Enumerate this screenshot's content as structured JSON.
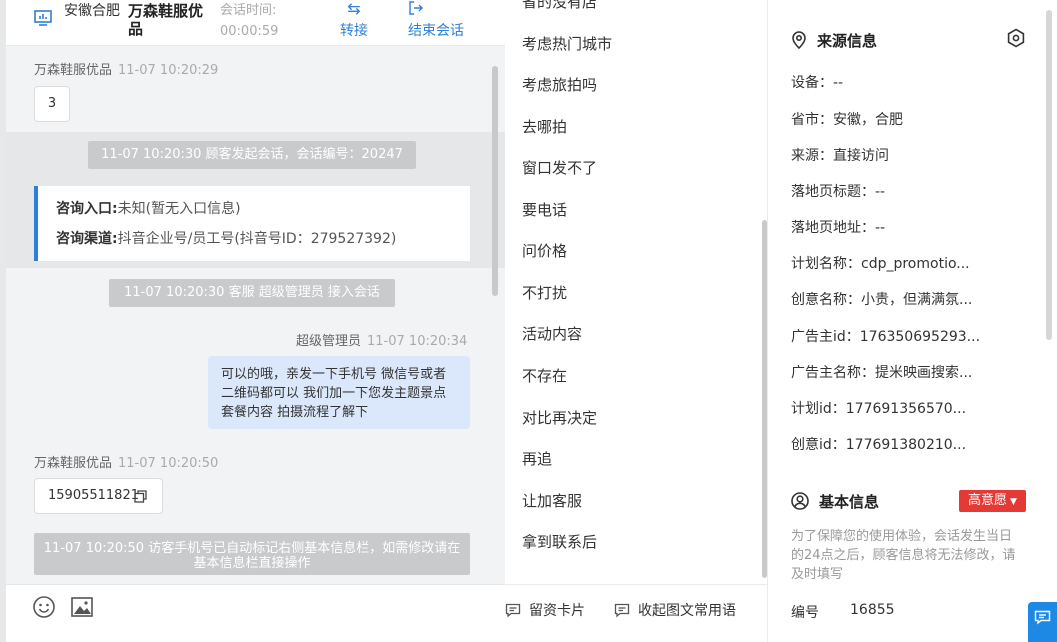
{
  "header": {
    "location": "安徽合肥",
    "shop_name": "万森鞋服优品",
    "time_label": "会话时间:",
    "time_value": "00:00:59",
    "transfer_label": "转接",
    "end_label": "结束会话"
  },
  "messages": {
    "m1_sender": "万森鞋服优品",
    "m1_time": "11-07 10:20:29",
    "m1_text": "3",
    "sys1": "11-07 10:20:30 顾客发起会话，会话编号：20247",
    "entry_label": "咨询入口:",
    "entry_value": "未知(暂无入口信息)",
    "channel_label": "咨询渠道:",
    "channel_value": "抖音企业号/员工号(抖音号ID：279527392)",
    "sys2": "11-07 10:20:30 客服 超级管理员 接入会话",
    "m2_sender": "超级管理员",
    "m2_time": "11-07 10:20:34",
    "m2_text": "可以的哦，亲发一下手机号 微信号或者二维码都可以 我们加一下您发主题景点 套餐内容 拍摄流程了解下",
    "m3_sender": "万森鞋服优品",
    "m3_time": "11-07 10:20:50",
    "m3_text": "15905511821",
    "sys3": "11-07 10:20:50 访客手机号已自动标记右侧基本信息栏，如需修改请在基本信息栏直接操作"
  },
  "quick_replies": [
    "省的没有店",
    "考虑热门城市",
    "考虑旅拍吗",
    "去哪拍",
    "窗口发不了",
    "要电话",
    "问价格",
    "不打扰",
    "活动内容",
    "不存在",
    "对比再决定",
    "再追",
    "让加客服",
    "拿到联系后"
  ],
  "footer": {
    "card_label": "留资卡片",
    "collect_label": "收起图文常用语"
  },
  "source_info": {
    "title": "来源信息",
    "device": "设备：--",
    "province_city": "省市：安徽，合肥",
    "source": "来源：直接访问",
    "landing_title": "落地页标题：--",
    "landing_url": "落地页地址：--",
    "plan_name": "计划名称：cdp_promotio...",
    "creative_name": "创意名称：小贵，但满满氛...",
    "advertiser_id": "广告主id：176350695293...",
    "advertiser_name": "广告主名称：提米映画搜索...",
    "plan_id": "计划id：177691356570...",
    "creative_id": "创意id：177691380210..."
  },
  "basic_info": {
    "title": "基本信息",
    "intent": "高意愿",
    "hint": "为了保障您的使用体验，会话发生当日的24点之后，顾客信息将无法修改，请及时填写",
    "number_label": "编号",
    "number_value": "16855"
  }
}
